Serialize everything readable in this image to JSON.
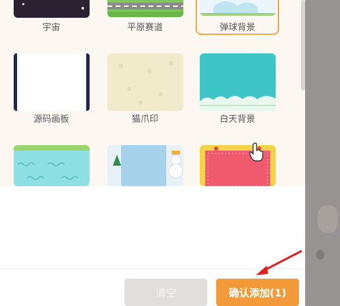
{
  "backgrounds": [
    {
      "label": "宇宙"
    },
    {
      "label": "平原赛道"
    },
    {
      "label": "弹球背景"
    },
    {
      "label": "源码画板"
    },
    {
      "label": "猫爪印"
    },
    {
      "label": "白天背景"
    },
    {
      "label": ""
    },
    {
      "label": ""
    },
    {
      "label": ""
    }
  ],
  "footer": {
    "clear_label": "清空",
    "confirm_label": "确认添加(1)"
  },
  "colors": {
    "accent": "#f39a3a",
    "selected_border": "#f2a54a",
    "disabled_button": "#e0dfde"
  }
}
